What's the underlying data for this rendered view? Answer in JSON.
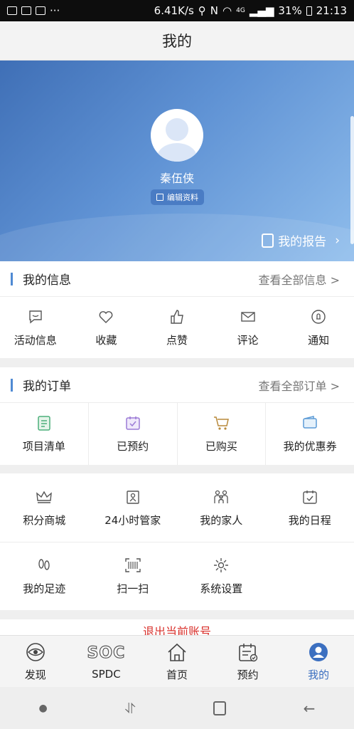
{
  "status": {
    "speed": "6.41K/s",
    "battery": "31%",
    "time": "21:13",
    "network": "4G"
  },
  "header": {
    "title": "我的"
  },
  "profile": {
    "name": "秦伍侠",
    "edit_label": "编辑资料",
    "report_label": "我的报告"
  },
  "info_section": {
    "title": "我的信息",
    "more": "查看全部信息 >",
    "items": [
      {
        "label": "活动信息",
        "icon": "chat-bubble-icon"
      },
      {
        "label": "收藏",
        "icon": "heart-icon"
      },
      {
        "label": "点赞",
        "icon": "thumbs-up-icon"
      },
      {
        "label": "评论",
        "icon": "envelope-icon"
      },
      {
        "label": "通知",
        "icon": "bell-icon"
      }
    ]
  },
  "order_section": {
    "title": "我的订单",
    "more": "查看全部订单 >",
    "items": [
      {
        "label": "项目清单",
        "icon": "clipboard-icon"
      },
      {
        "label": "已预约",
        "icon": "calendar-check-icon"
      },
      {
        "label": "已购买",
        "icon": "cart-icon"
      },
      {
        "label": "我的优惠券",
        "icon": "wallet-icon"
      }
    ]
  },
  "services": {
    "row1": [
      {
        "label": "积分商城",
        "icon": "crown-icon"
      },
      {
        "label": "24小时管家",
        "icon": "butler-icon"
      },
      {
        "label": "我的家人",
        "icon": "family-icon"
      },
      {
        "label": "我的日程",
        "icon": "schedule-icon"
      }
    ],
    "row2": [
      {
        "label": "我的足迹",
        "icon": "footprints-icon"
      },
      {
        "label": "扫一扫",
        "icon": "barcode-scan-icon"
      },
      {
        "label": "系统设置",
        "icon": "gear-icon"
      }
    ]
  },
  "logout": {
    "label": "退出当前账号"
  },
  "tabbar": [
    {
      "label": "发现",
      "icon": "eye-icon"
    },
    {
      "label": "SPDC",
      "icon": "spdc-logo-icon"
    },
    {
      "label": "首页",
      "icon": "home-icon"
    },
    {
      "label": "预约",
      "icon": "calendar-icon"
    },
    {
      "label": "我的",
      "icon": "profile-icon"
    }
  ],
  "colors": {
    "accent": "#3b6fc0",
    "section_bar": "#4f8ad3",
    "icon_green": "#4caf7a",
    "icon_purple": "#9b7ad6",
    "logout_red": "#d9302b"
  }
}
